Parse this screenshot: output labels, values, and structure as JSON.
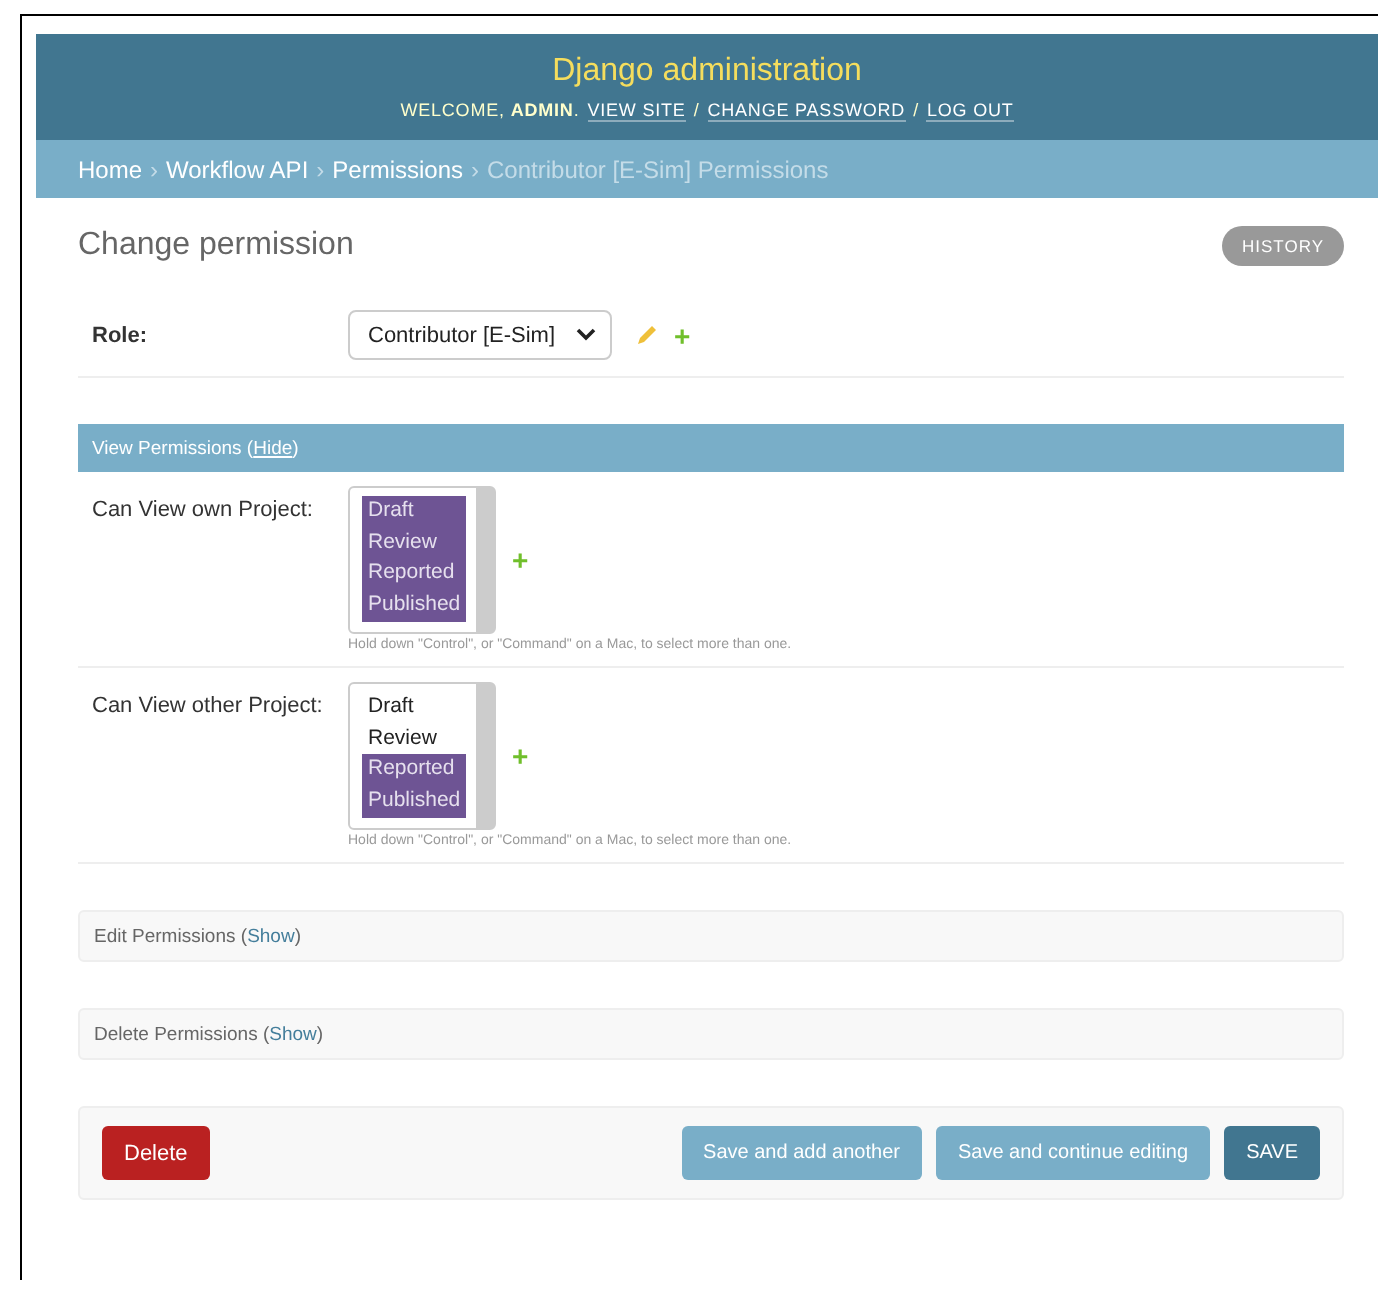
{
  "header": {
    "title": "Django administration",
    "greeting": "WELCOME, **ADMIN**.",
    "separator": "/",
    "links": [
      "VIEW SITE",
      "CHANGE PASSWORD",
      "LOG OUT"
    ]
  },
  "breadcrumbs": {
    "separator": "›",
    "items": [
      {
        "label": "Home",
        "current": false
      },
      {
        "label": "Workflow API",
        "current": false
      },
      {
        "label": "Permissions",
        "current": false
      },
      {
        "label": "Contributor [E-Sim] Permissions",
        "current": true
      }
    ]
  },
  "page_title": "Change permission",
  "history_button": "HISTORY",
  "role": {
    "label": "Role:",
    "value": "Contributor [E-Sim]",
    "add_icon": "+"
  },
  "fieldsets": [
    {
      "title": "View Permissions (",
      "toggle": "Hide",
      "title_end": ")",
      "expanded": true,
      "fields": [
        {
          "label": "Can View own Project:",
          "add_icon": "+",
          "help": "Hold down \"Control\", or \"Command\" on a Mac, to select more than one.",
          "options": [
            {
              "label": "Draft",
              "selected": true
            },
            {
              "label": "Review",
              "selected": true
            },
            {
              "label": "Reported",
              "selected": true
            },
            {
              "label": "Published",
              "selected": true
            }
          ]
        },
        {
          "label": "Can View other Project:",
          "add_icon": "+",
          "help": "Hold down \"Control\", or \"Command\" on a Mac, to select more than one.",
          "options": [
            {
              "label": "Draft",
              "selected": false
            },
            {
              "label": "Review",
              "selected": false
            },
            {
              "label": "Reported",
              "selected": true
            },
            {
              "label": "Published",
              "selected": true
            }
          ]
        }
      ]
    },
    {
      "title": "Edit Permissions (",
      "toggle": "Show",
      "title_end": ")",
      "expanded": false
    },
    {
      "title": "Delete Permissions (",
      "toggle": "Show",
      "title_end": ")",
      "expanded": false
    }
  ],
  "buttons": [
    {
      "label": "Delete",
      "kind": "delete"
    },
    {
      "label": "Save and add another",
      "kind": "secondary"
    },
    {
      "label": "Save and continue editing",
      "kind": "secondary"
    },
    {
      "label": "SAVE",
      "kind": "primary"
    }
  ]
}
